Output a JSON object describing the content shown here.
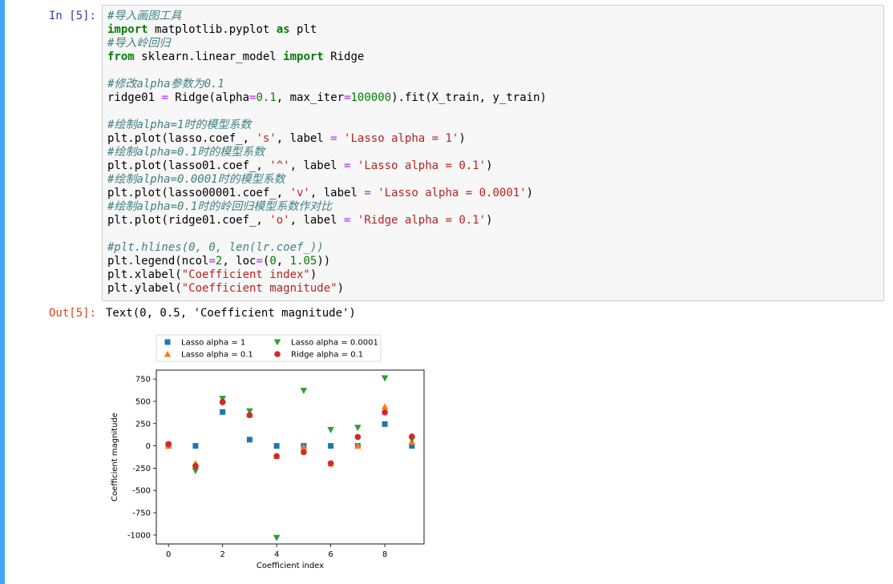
{
  "cell": {
    "in_prompt": "In [5]:",
    "out_prompt": "Out[5]:",
    "output_text": "Text(0, 0.5, 'Coefficient magnitude')",
    "code_lines": [
      [
        {
          "t": "#导入画图工具",
          "c": "c"
        }
      ],
      [
        {
          "t": "import",
          "c": "k"
        },
        {
          "t": " matplotlib.pyplot "
        },
        {
          "t": "as",
          "c": "k"
        },
        {
          "t": " plt"
        }
      ],
      [
        {
          "t": "#导入岭回归",
          "c": "c"
        }
      ],
      [
        {
          "t": "from",
          "c": "k"
        },
        {
          "t": " sklearn.linear_model "
        },
        {
          "t": "import",
          "c": "k"
        },
        {
          "t": " Ridge"
        }
      ],
      [],
      [
        {
          "t": "#修改alpha参数为0.1",
          "c": "c"
        }
      ],
      [
        {
          "t": "ridge01 "
        },
        {
          "t": "=",
          "c": "o"
        },
        {
          "t": " Ridge(alpha"
        },
        {
          "t": "=",
          "c": "o"
        },
        {
          "t": "0.1",
          "c": "n"
        },
        {
          "t": ", max_iter"
        },
        {
          "t": "=",
          "c": "o"
        },
        {
          "t": "100000",
          "c": "n"
        },
        {
          "t": ").fit(X_train, y_train)"
        }
      ],
      [],
      [
        {
          "t": "#绘制alpha=1时的模型系数",
          "c": "c"
        }
      ],
      [
        {
          "t": "plt.plot(lasso.coef_, "
        },
        {
          "t": "'s'",
          "c": "s"
        },
        {
          "t": ", label "
        },
        {
          "t": "=",
          "c": "o"
        },
        {
          "t": " "
        },
        {
          "t": "'Lasso alpha = 1'",
          "c": "s"
        },
        {
          "t": ")"
        }
      ],
      [
        {
          "t": "#绘制alpha=0.1时的模型系数",
          "c": "c"
        }
      ],
      [
        {
          "t": "plt.plot(lasso01.coef_, "
        },
        {
          "t": "'^'",
          "c": "s"
        },
        {
          "t": ", label "
        },
        {
          "t": "=",
          "c": "o"
        },
        {
          "t": " "
        },
        {
          "t": "'Lasso alpha = 0.1'",
          "c": "s"
        },
        {
          "t": ")"
        }
      ],
      [
        {
          "t": "#绘制alpha=0.0001时的模型系数",
          "c": "c"
        }
      ],
      [
        {
          "t": "plt.plot(lasso00001.coef_, "
        },
        {
          "t": "'v'",
          "c": "s"
        },
        {
          "t": ", label "
        },
        {
          "t": "=",
          "c": "o"
        },
        {
          "t": " "
        },
        {
          "t": "'Lasso alpha = 0.0001'",
          "c": "s"
        },
        {
          "t": ")"
        }
      ],
      [
        {
          "t": "#绘制alpha=0.1时的岭回归模型系数作对比",
          "c": "c"
        }
      ],
      [
        {
          "t": "plt.plot(ridge01.coef_, "
        },
        {
          "t": "'o'",
          "c": "s"
        },
        {
          "t": ", label "
        },
        {
          "t": "=",
          "c": "o"
        },
        {
          "t": " "
        },
        {
          "t": "'Ridge alpha = 0.1'",
          "c": "s"
        },
        {
          "t": ")"
        }
      ],
      [],
      [
        {
          "t": "#plt.hlines(0, 0, len(lr.coef_))",
          "c": "c"
        }
      ],
      [
        {
          "t": "plt.legend(ncol"
        },
        {
          "t": "=",
          "c": "o"
        },
        {
          "t": "2",
          "c": "n"
        },
        {
          "t": ", loc"
        },
        {
          "t": "=",
          "c": "o"
        },
        {
          "t": "("
        },
        {
          "t": "0",
          "c": "n"
        },
        {
          "t": ", "
        },
        {
          "t": "1.05",
          "c": "n"
        },
        {
          "t": "))"
        }
      ],
      [
        {
          "t": "plt.xlabel("
        },
        {
          "t": "\"Coefficient index\"",
          "c": "s"
        },
        {
          "t": ")"
        }
      ],
      [
        {
          "t": "plt.ylabel("
        },
        {
          "t": "\"Coefficient magnitude\"",
          "c": "s"
        },
        {
          "t": ")"
        }
      ]
    ]
  },
  "chart_data": {
    "type": "scatter",
    "xlabel": "Coefficient index",
    "ylabel": "Coefficient magnitude",
    "xlim": [
      -0.45,
      9.45
    ],
    "ylim": [
      -1100,
      850
    ],
    "xticks": [
      0,
      2,
      4,
      6,
      8
    ],
    "yticks": [
      750,
      500,
      250,
      0,
      -250,
      -500,
      -750,
      -1000
    ],
    "legend_placement": "above-left, 2 columns",
    "x": [
      0,
      1,
      2,
      3,
      4,
      5,
      6,
      7,
      8,
      9
    ],
    "series": [
      {
        "name": "Lasso alpha = 1",
        "marker": "square",
        "color": "#1f77b4",
        "values": [
          0,
          0,
          380,
          70,
          0,
          0,
          0,
          0,
          245,
          0
        ]
      },
      {
        "name": "Lasso alpha = 0.1",
        "marker": "triangle-up",
        "color": "#ff7f0e",
        "values": [
          0,
          -195,
          525,
          350,
          -115,
          -15,
          -200,
          0,
          440,
          45
        ]
      },
      {
        "name": "Lasso alpha = 0.0001",
        "marker": "triangle-down",
        "color": "#2ca02c",
        "values": [
          10,
          -280,
          530,
          390,
          -1030,
          620,
          180,
          205,
          760,
          70
        ]
      },
      {
        "name": "Ridge alpha = 0.1",
        "marker": "circle",
        "color": "#d62728",
        "values": [
          20,
          -225,
          490,
          345,
          -115,
          -70,
          -195,
          100,
          375,
          105
        ]
      }
    ]
  }
}
